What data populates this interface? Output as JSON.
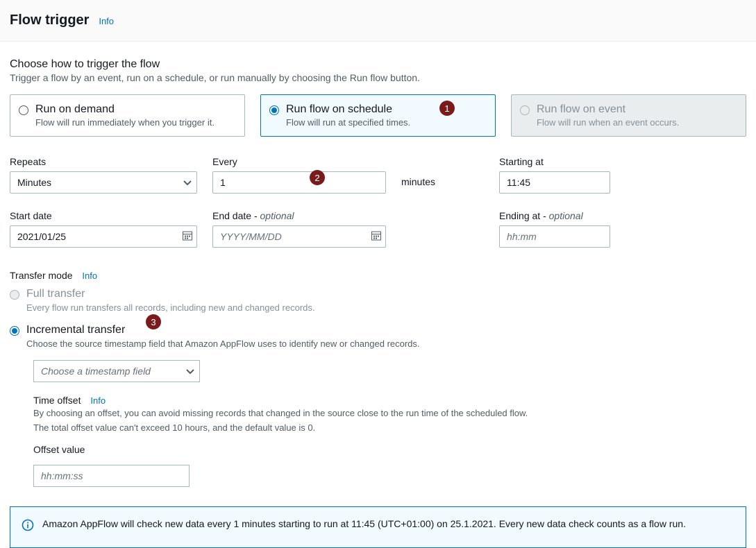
{
  "header": {
    "title": "Flow trigger",
    "info": "Info"
  },
  "section": {
    "title": "Choose how to trigger the flow",
    "desc": "Trigger a flow by an event, run on a schedule, or run manually by choosing the Run flow button."
  },
  "tiles": {
    "demand": {
      "title": "Run on demand",
      "sub": "Flow will run immediately when you trigger it."
    },
    "schedule": {
      "title": "Run flow on schedule",
      "sub": "Flow will run at specified times."
    },
    "event": {
      "title": "Run flow on event",
      "sub": "Flow will run when an event occurs."
    }
  },
  "callouts": {
    "c1": "1",
    "c2": "2",
    "c3": "3"
  },
  "schedule": {
    "repeats_label": "Repeats",
    "repeats_value": "Minutes",
    "every_label": "Every",
    "every_value": "1",
    "unit": "minutes",
    "starting_label": "Starting at",
    "starting_value": "11:45",
    "startdate_label": "Start date",
    "startdate_value": "2021/01/25",
    "enddate_label": "End date - ",
    "enddate_opt": "optional",
    "enddate_placeholder": "YYYY/MM/DD",
    "ending_label": "Ending at - ",
    "ending_opt": "optional",
    "ending_placeholder": "hh:mm"
  },
  "transfer": {
    "label": "Transfer mode",
    "info": "Info",
    "full_title": "Full transfer",
    "full_sub": "Every flow run transfers all records, including new and changed records.",
    "inc_title": "Incremental transfer",
    "inc_sub": "Choose the source timestamp field that Amazon AppFlow uses to identify new or changed records.",
    "timestamp_placeholder": "Choose a timestamp field",
    "offset_title": "Time offset",
    "offset_info": "Info",
    "offset_desc1": "By choosing an offset, you can avoid missing records that changed in the source close to the run time of the scheduled flow.",
    "offset_desc2": "The total offset value can't exceed 10 hours, and the default value is 0.",
    "offset_value_label": "Offset value",
    "offset_placeholder": "hh:mm:ss"
  },
  "banner": {
    "msg": "Amazon AppFlow will check new data every 1 minutes starting to run at 11:45 (UTC+01:00) on 25.1.2021. Every new data check counts as a flow run."
  }
}
